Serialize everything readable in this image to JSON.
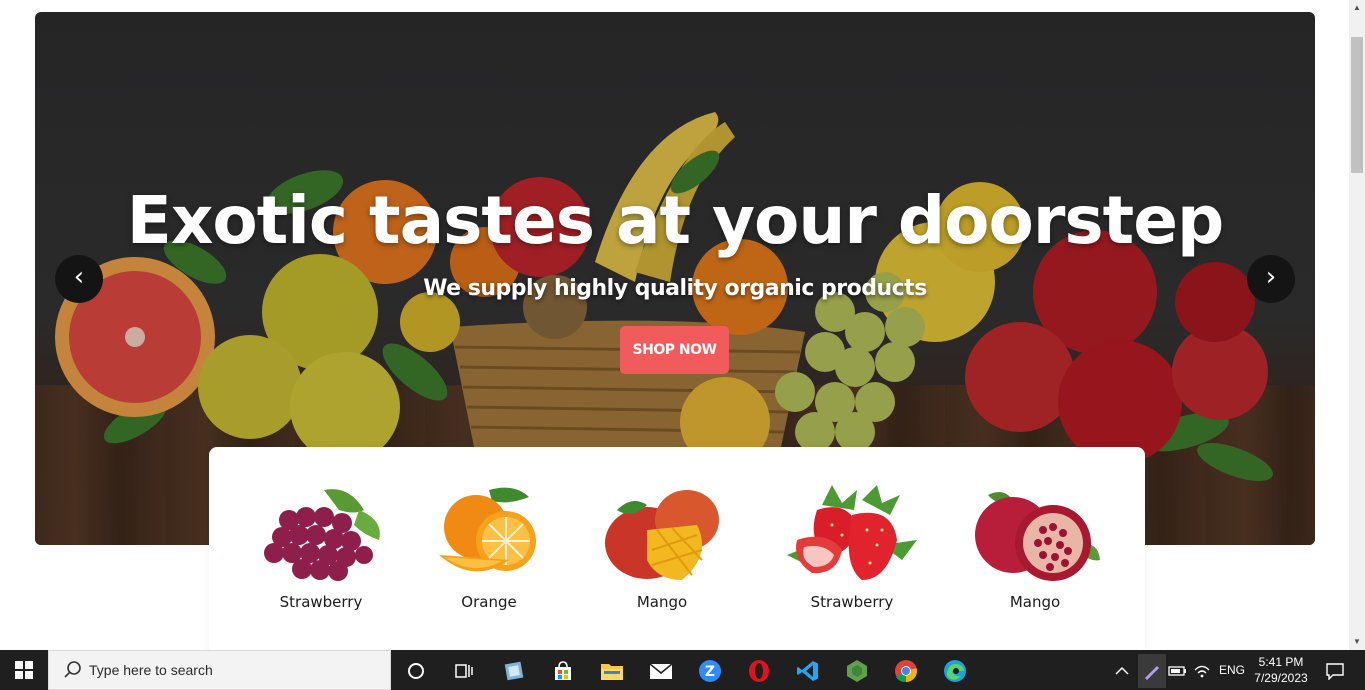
{
  "hero": {
    "title": "Exotic tastes at your doorstep",
    "subtitle": "We supply highly quality organic products",
    "cta": "SHOP NOW",
    "prev_arrow": "‹",
    "next_arrow": "›",
    "accent_color": "#f25b5b"
  },
  "categories": [
    {
      "label": "Strawberry",
      "icon": "grapes-image"
    },
    {
      "label": "Orange",
      "icon": "orange-image"
    },
    {
      "label": "Mango",
      "icon": "mango-image"
    },
    {
      "label": "Strawberry",
      "icon": "strawberry-image"
    },
    {
      "label": "Mango",
      "icon": "pomegranate-image"
    }
  ],
  "taskbar": {
    "search_placeholder": "Type here to search",
    "apps": [
      "cortana-icon",
      "task-view-icon",
      "notepad-icon",
      "store-icon",
      "file-explorer-icon",
      "mail-icon",
      "zoom-icon",
      "opera-icon",
      "vscode-icon",
      "nodejs-icon",
      "chrome-icon",
      "edge-icon"
    ],
    "language": "ENG",
    "time": "5:41 PM",
    "date": "7/29/2023"
  }
}
